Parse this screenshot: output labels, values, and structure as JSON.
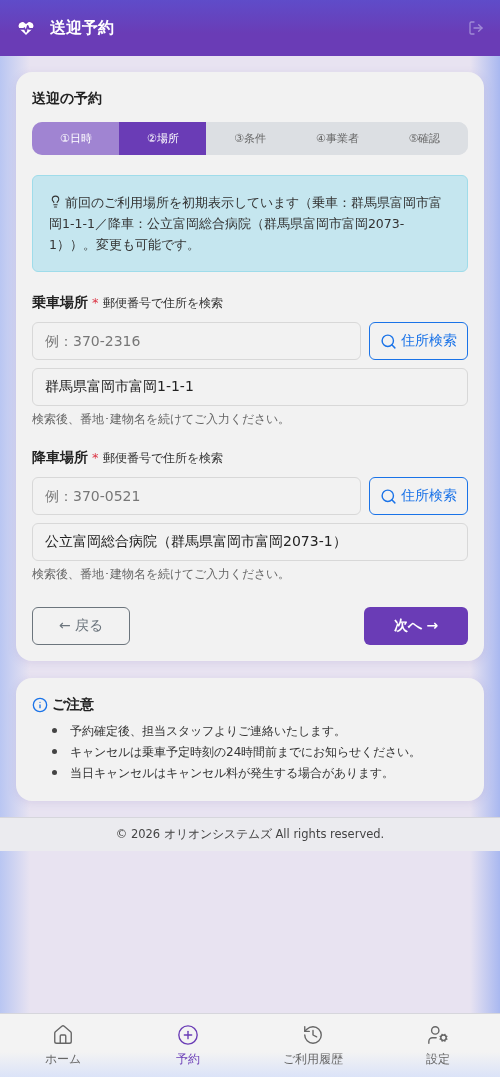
{
  "header": {
    "title": "送迎予約"
  },
  "card": {
    "title": "送迎の予約",
    "steps": [
      {
        "label": "①日時",
        "selected": false,
        "done": true
      },
      {
        "label": "②場所",
        "selected": true,
        "done": false
      },
      {
        "label": "③条件",
        "selected": false,
        "done": false
      },
      {
        "label": "④事業者",
        "selected": false,
        "done": false
      },
      {
        "label": "⑤確認",
        "selected": false,
        "done": false
      }
    ],
    "info": "前回のご利用場所を初期表示しています（乗車：群馬県富岡市富岡1-1-1／降車：公立富岡総合病院（群馬県富岡市富岡2073-1））。変更も可能です。",
    "sections": [
      {
        "label": "乗車場所",
        "required_mark": "*",
        "sublabel": "郵便番号で住所を検索",
        "postal_placeholder": "例：370-2316",
        "search_button": "住所検索",
        "address": "群馬県富岡市富岡1-1-1",
        "hint": "検索後、番地･建物名を続けてご入力ください。"
      },
      {
        "label": "降車場所",
        "required_mark": "*",
        "sublabel": "郵便番号で住所を検索",
        "postal_placeholder": "例：370-0521",
        "search_button": "住所検索",
        "address": "公立富岡総合病院（群馬県富岡市富岡2073-1）",
        "hint": "検索後、番地･建物名を続けてご入力ください。"
      }
    ],
    "back_button": "← 戻る",
    "next_button": "次へ →"
  },
  "notice": {
    "title": "ご注意",
    "items": [
      "予約確定後、担当スタッフよりご連絡いたします。",
      "キャンセルは乗車予定時刻の24時間前までにお知らせください。",
      "当日キャンセルはキャンセル料が発生する場合があります。"
    ]
  },
  "footer": "© 2026 オリオンシステムズ All rights reserved.",
  "nav": [
    {
      "kind": "home",
      "label": "ホーム",
      "selected": false
    },
    {
      "kind": "reserve",
      "label": "予約",
      "selected": true
    },
    {
      "kind": "history",
      "label": "ご利用履歴",
      "selected": false
    },
    {
      "kind": "settings",
      "label": "設定",
      "selected": false
    }
  ]
}
